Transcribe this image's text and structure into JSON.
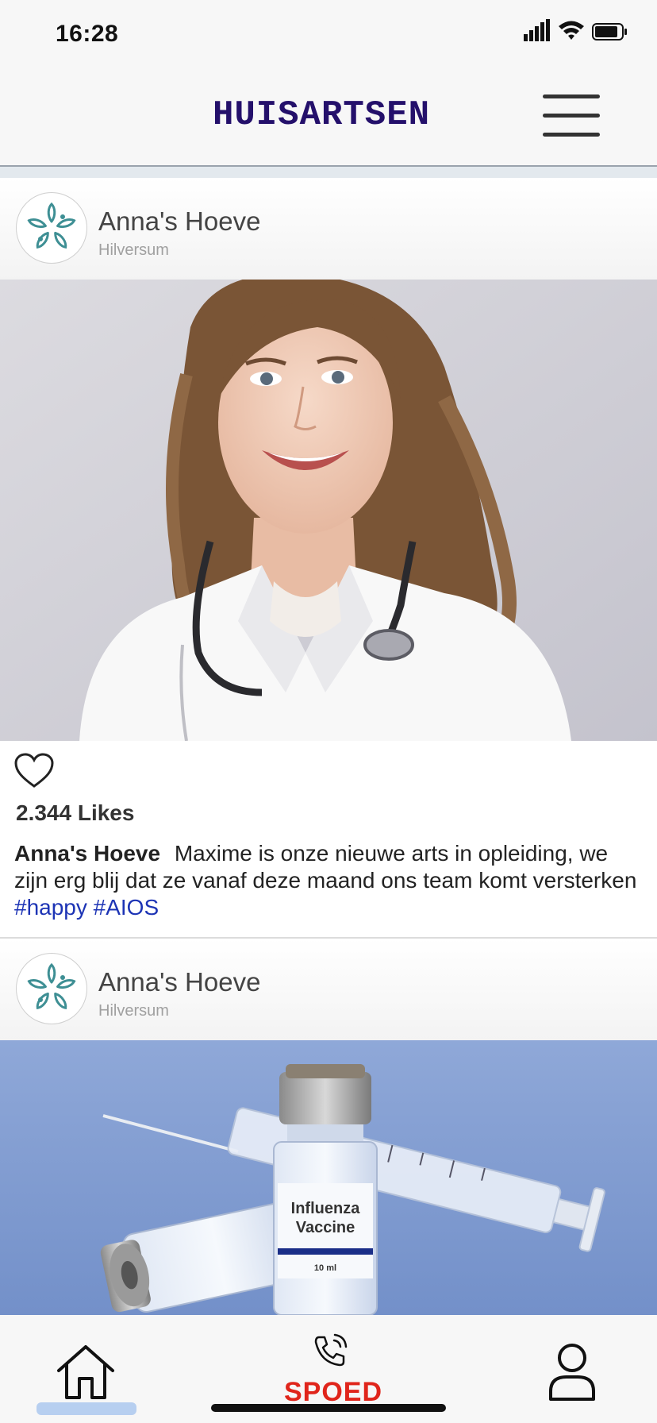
{
  "status_bar": {
    "time": "16:28"
  },
  "header": {
    "title": "HUISARTSEN"
  },
  "posts": [
    {
      "author": "Anna's Hoeve",
      "location": "Hilversum",
      "image": "smiling doctor with stethoscope",
      "likes": "2.344 Likes",
      "caption_author": "Anna's Hoeve",
      "caption_text": "Maxime is onze nieuwe arts in opleiding, we zijn erg blij dat ze vanaf deze maand ons team komt versterken",
      "hashtags": [
        "#happy",
        "#AIOS"
      ]
    },
    {
      "author": "Anna's Hoeve",
      "location": "Hilversum",
      "image": "influenza vaccine vial and syringe",
      "vial_label_line1": "Influenza",
      "vial_label_line2": "Vaccine",
      "vial_volume": "10 ml"
    }
  ],
  "bottom_nav": {
    "spoed_label": "SPOED"
  },
  "colors": {
    "title": "#24106b",
    "hashtag": "#1d34b5",
    "spoed": "#e0251b",
    "active_tab": "#b7cff0"
  }
}
